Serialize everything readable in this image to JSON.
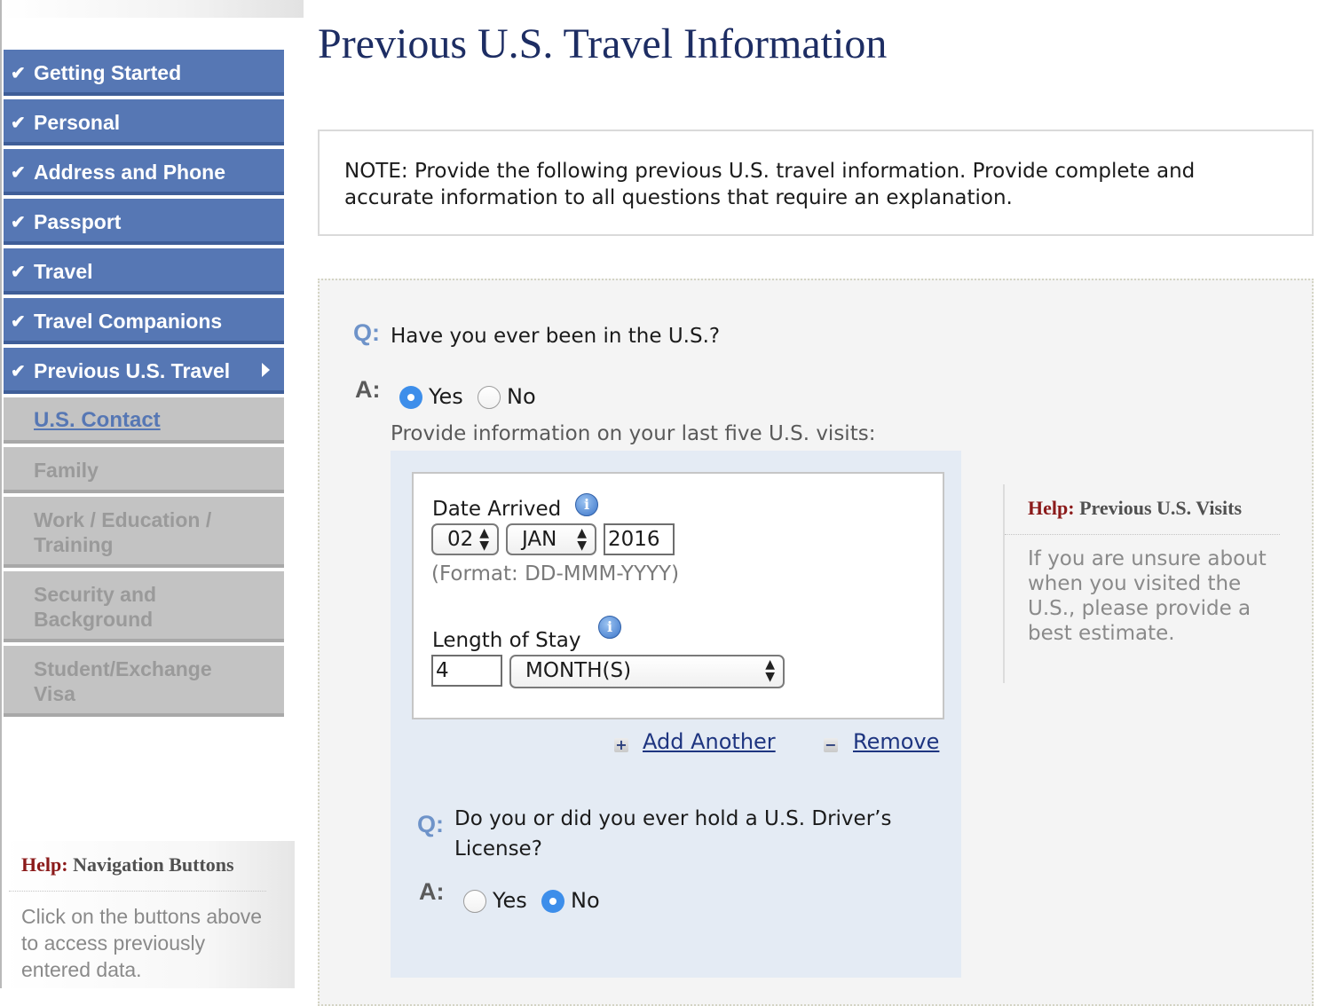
{
  "page": {
    "title": "Previous U.S. Travel Information",
    "note": "NOTE: Provide the following previous U.S. travel information. Provide complete and accurate information to all questions that require an explanation."
  },
  "sidebar": {
    "items": [
      {
        "label": "Getting Started",
        "status": "complete"
      },
      {
        "label": "Personal",
        "status": "complete"
      },
      {
        "label": "Address and Phone",
        "status": "complete"
      },
      {
        "label": "Passport",
        "status": "complete"
      },
      {
        "label": "Travel",
        "status": "complete"
      },
      {
        "label": "Travel Companions",
        "status": "complete"
      },
      {
        "label": "Previous U.S. Travel",
        "status": "current"
      },
      {
        "label": "U.S. Contact",
        "status": "next"
      },
      {
        "label": "Family",
        "status": "pending"
      },
      {
        "label": "Work / Education / Training",
        "status": "pending"
      },
      {
        "label": "Security and Background",
        "status": "pending"
      },
      {
        "label": "Student/Exchange Visa",
        "status": "pending"
      }
    ],
    "help": {
      "prefix": "Help:",
      "title": "Navigation Buttons",
      "text": "Click on the buttons above to access previously entered data."
    }
  },
  "form": {
    "q_marker": "Q:",
    "a_marker": "A:",
    "q1": {
      "text": "Have you ever been in the U.S.?",
      "options": [
        "Yes",
        "No"
      ],
      "selected": "Yes"
    },
    "visits_instruction": "Provide information on your last five U.S. visits:",
    "visit": {
      "date_label": "Date Arrived",
      "day": "02",
      "month": "JAN",
      "year": "2016",
      "format_hint": "(Format: DD-MMM-YYYY)",
      "stay_label": "Length of Stay",
      "stay_value": "4",
      "stay_unit": "MONTH(S)"
    },
    "add_another": "Add Another",
    "remove": "Remove",
    "q2": {
      "text": "Do you or did you ever hold a U.S. Driver’s License?",
      "options": [
        "Yes",
        "No"
      ],
      "selected": "No"
    }
  },
  "side_help": {
    "prefix": "Help:",
    "title": "Previous U.S. Visits",
    "text": "If you are unsure about when you visited the U.S., please provide a best estimate."
  },
  "icons": {
    "check": "checkmark-icon",
    "current_arrow": "arrow-right-icon",
    "info": "info-icon",
    "add": "plus-icon",
    "remove": "minus-icon"
  },
  "colors": {
    "nav_complete": "#5677b4",
    "nav_pending": "#c3c3c3",
    "title": "#1d2d63",
    "help_word": "#8b1a1a",
    "radio_selected": "#3d8eea",
    "visits_panel": "#e4ebf4"
  }
}
